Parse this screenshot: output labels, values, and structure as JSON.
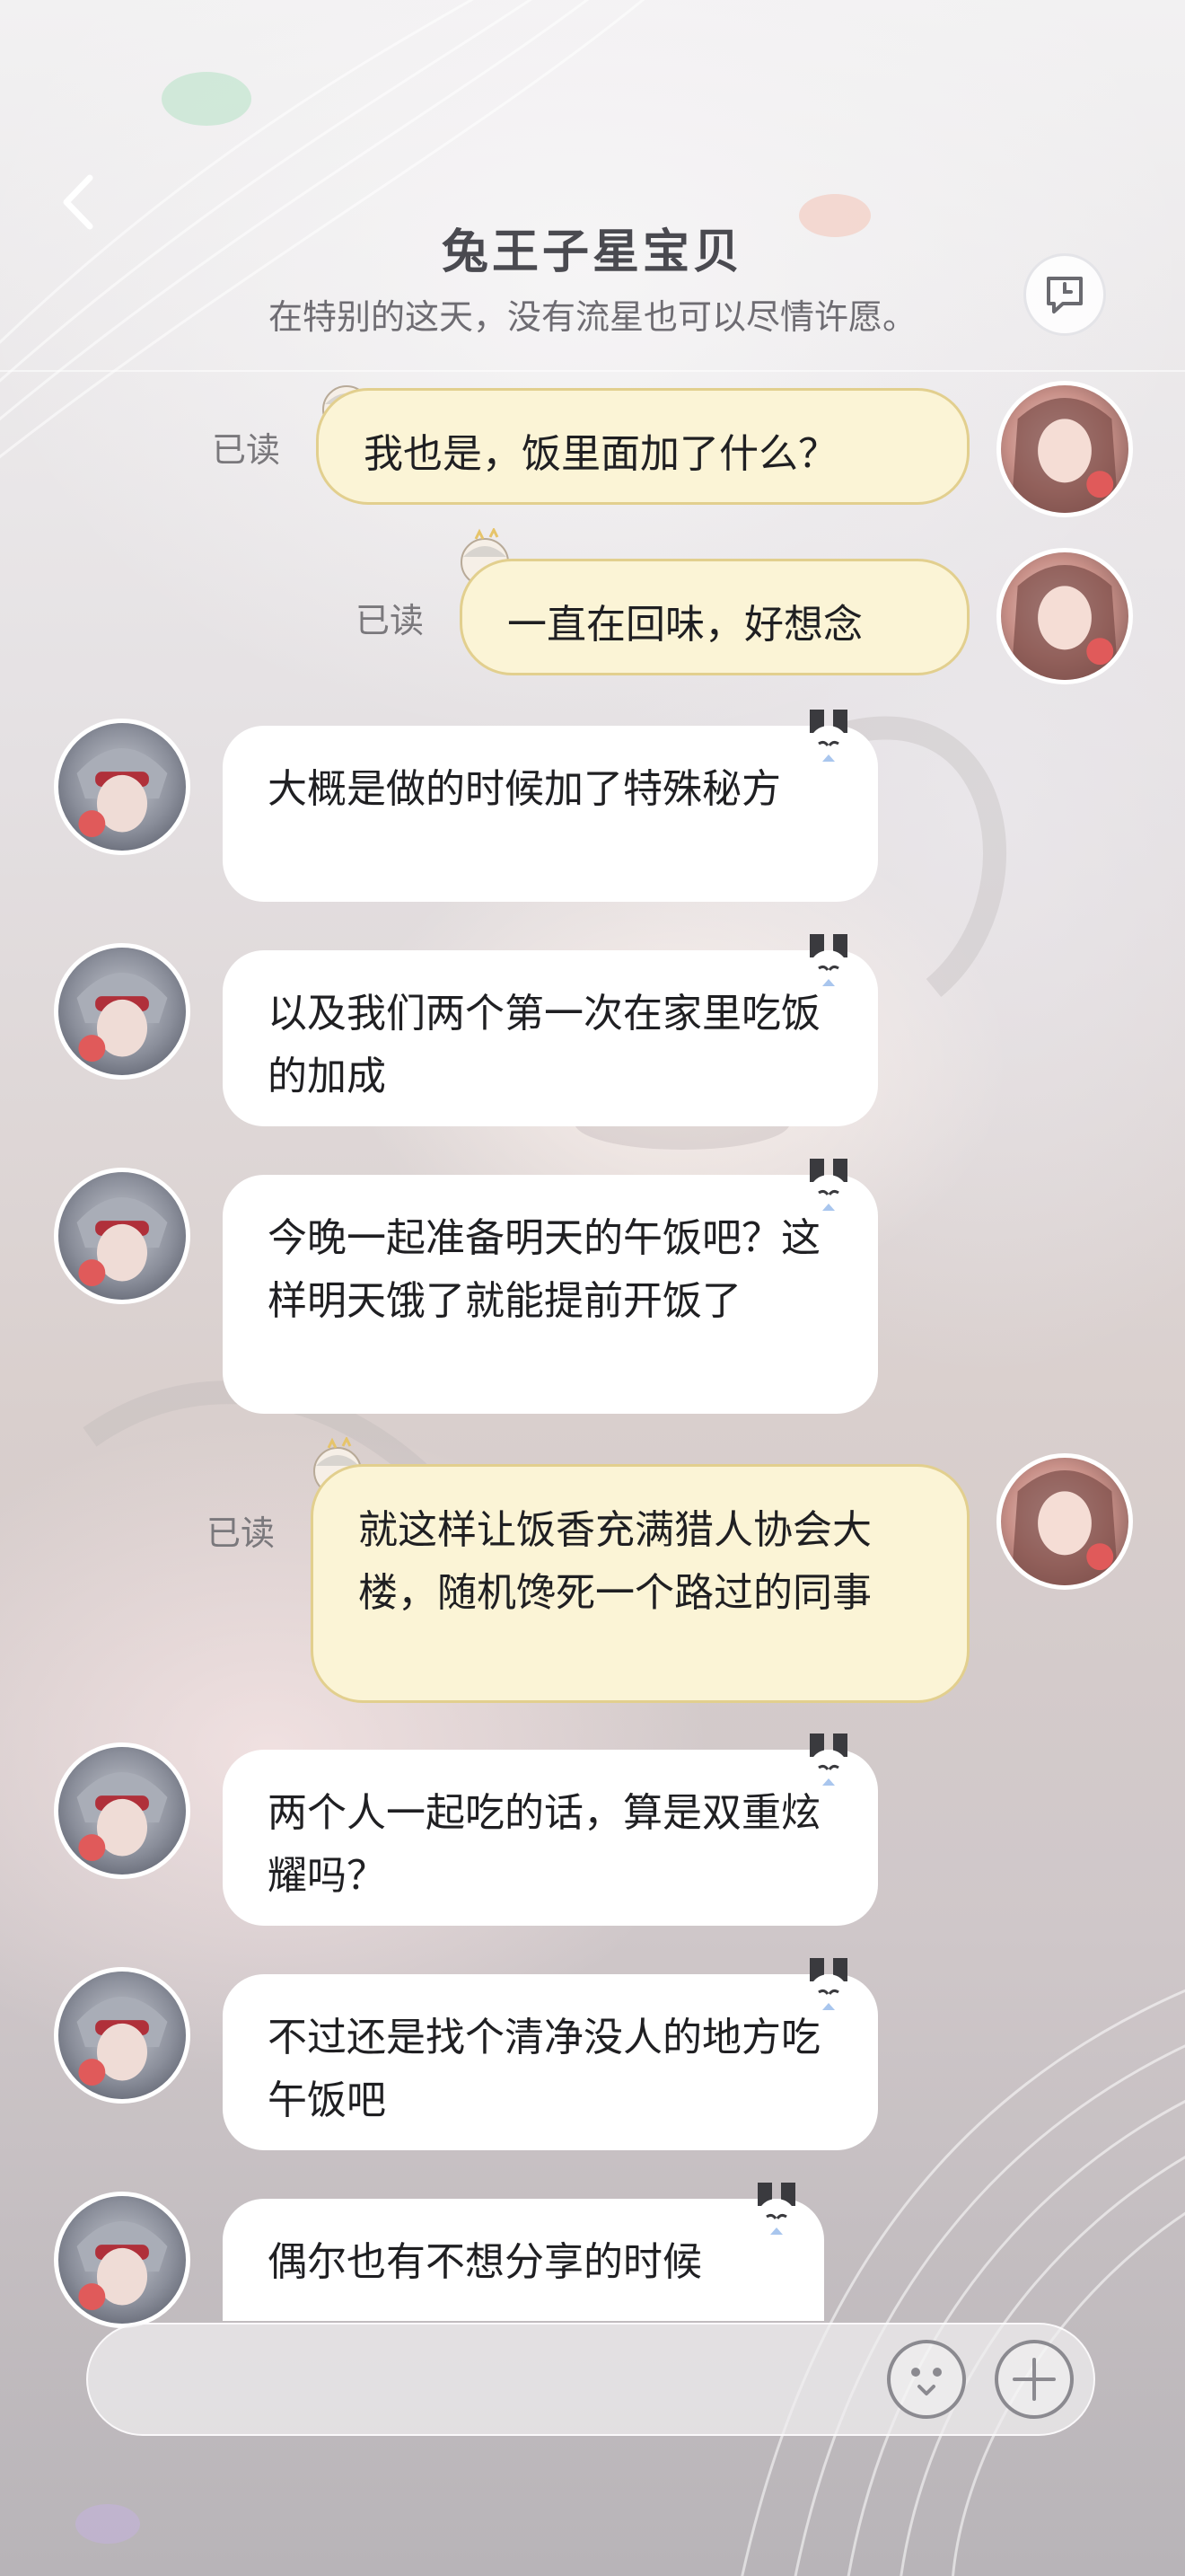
{
  "header": {
    "title": "兔王子星宝贝",
    "subtitle": "在特别的这天，没有流星也可以尽情许愿。"
  },
  "read_label": "已读",
  "messages": [
    {
      "side": "right",
      "text": "我也是，饭里面加了什么？",
      "read": true
    },
    {
      "side": "right",
      "text": "一直在回味，好想念",
      "read": true
    },
    {
      "side": "left",
      "text": "大概是做的时候加了特殊秘方"
    },
    {
      "side": "left",
      "text": "以及我们两个第一次在家里吃饭的加成"
    },
    {
      "side": "left",
      "text": "今晚一起准备明天的午饭吧？这样明天饿了就能提前开饭了"
    },
    {
      "side": "right",
      "text": "就这样让饭香充满猎人协会大楼，随机馋死一个路过的同事",
      "read": true
    },
    {
      "side": "left",
      "text": "两个人一起吃的话，算是双重炫耀吗？"
    },
    {
      "side": "left",
      "text": "不过还是找个清净没人的地方吃午饭吧"
    },
    {
      "side": "left",
      "text": "偶尔也有不想分享的时候"
    }
  ],
  "icons": {
    "back": "chevron-left-icon",
    "history": "chat-history-icon",
    "emoji": "emoji-face-icon",
    "add": "plus-circle-icon"
  },
  "colors": {
    "incoming_bubble": "#ffffff",
    "outgoing_bubble": "#fbf4d6",
    "outgoing_border": "#e2cf8e",
    "title": "#4a4a50"
  }
}
